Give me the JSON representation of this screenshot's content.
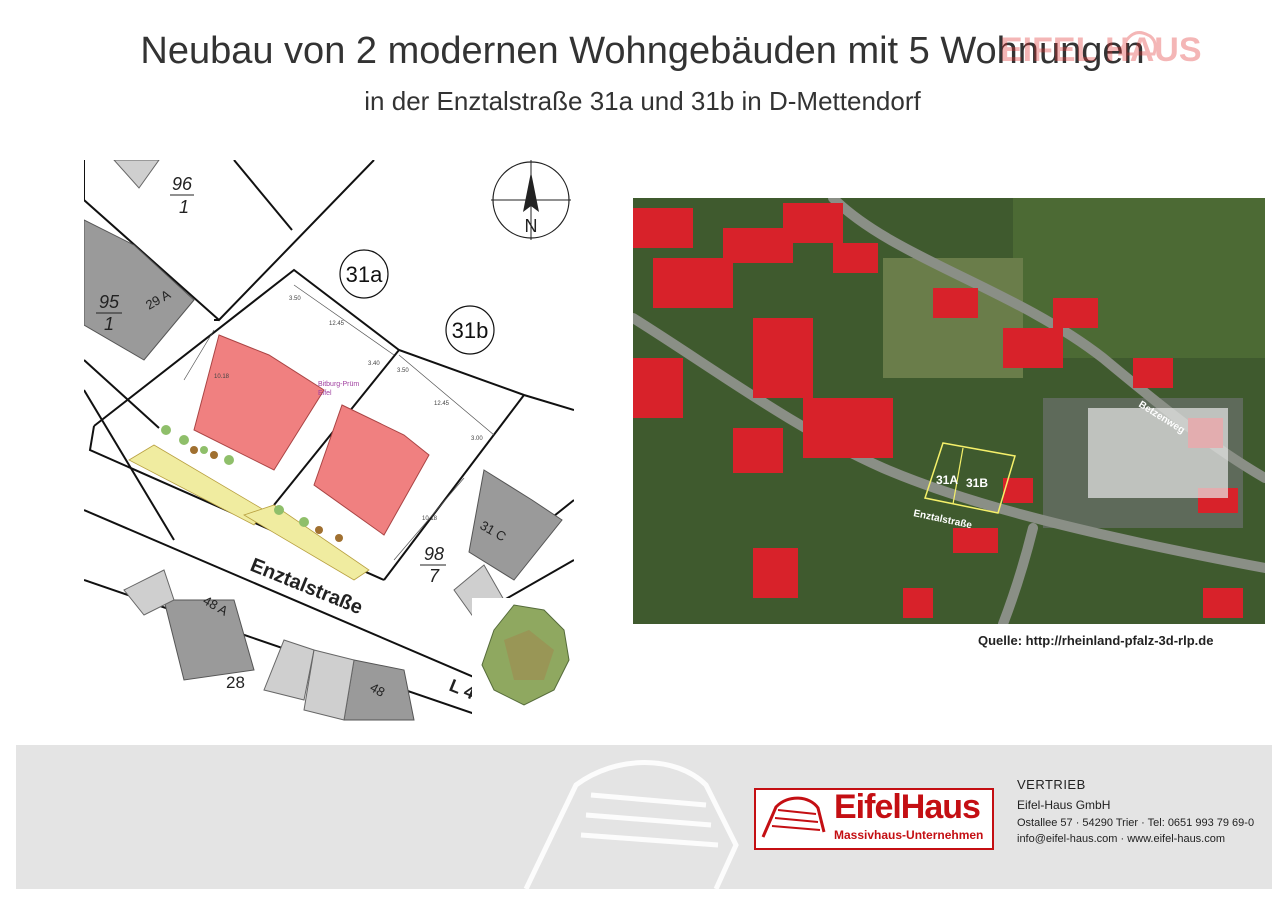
{
  "header": {
    "title": "Neubau von 2 modernen Wohngebäuden mit 5 Wohnungen",
    "subtitle": "in der Enztalstraße 31a und 31b in D-Mettendorf",
    "watermark_logo_text": "EIFEL HAUS"
  },
  "site_plan": {
    "parcel_96": "96",
    "parcel_96_sub": "1",
    "parcel_95": "95",
    "parcel_95_sub": "1",
    "parcel_98": "98",
    "parcel_98_sub": "7",
    "house_29a": "29 A",
    "house_31c": "31 C",
    "house_48a": "48 A",
    "house_48": "48",
    "number_28": "28",
    "label_31a": "31a",
    "label_31b": "31b",
    "street": "Enztalstraße",
    "road_label": "L 4",
    "district_text": "Bitburg-Prüm",
    "district_text2": "Eifel",
    "north_letter": "N",
    "dim_a1": "3.50",
    "dim_a2": "12.45",
    "dim_a3": "3.40",
    "dim_a4": "10.18",
    "dim_b1": "3.50",
    "dim_b2": "12.45",
    "dim_b3": "3.00",
    "dim_b4": "10.18"
  },
  "aerial": {
    "label_31a": "31A",
    "label_31b": "31B",
    "street_enztal": "Enztalstraße",
    "street_betzen": "Betzenweg",
    "colors": {
      "roof": "#d8222a",
      "vegetation": "#3f5a2e",
      "road": "#8a8f86"
    }
  },
  "source": "Quelle: http://rheinland-pfalz-3d-rlp.de",
  "footer": {
    "brand_name": "EifelHaus",
    "brand_tagline": "Massivhaus-Unternehmen",
    "section_label": "VERTRIEB",
    "company": "Eifel-Haus GmbH",
    "address": "Ostallee 57 · 54290 Trier · Tel: 0651 993 79 69-0",
    "contact": "info@eifel-haus.com · www.eifel-haus.com",
    "brand_color": "#c40f13"
  }
}
